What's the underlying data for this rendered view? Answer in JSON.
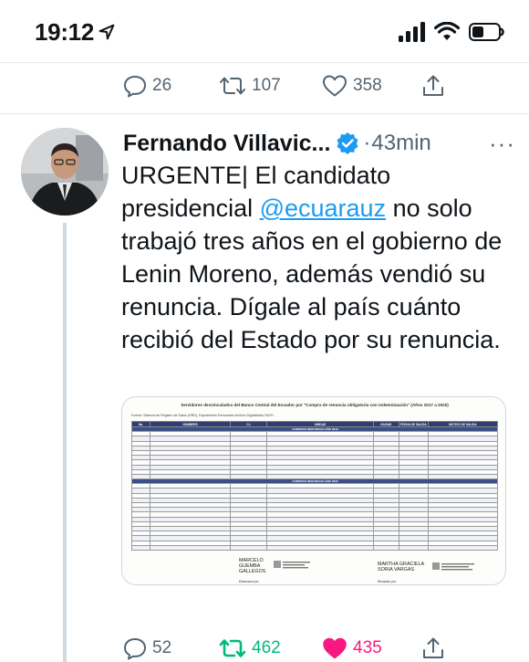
{
  "status_bar": {
    "time": "19:12"
  },
  "top_actions": {
    "reply_count": "26",
    "retweet_count": "107",
    "like_count": "358"
  },
  "tweet": {
    "author": "Fernando Villavic...",
    "time": "43min",
    "more": "···",
    "text_before_mention": "URGENTE| El candidato presidencial ",
    "mention": "@ecuarauz",
    "text_after_mention": " no solo trabajó tres años en el gobierno de Lenin Moreno, además vendió su renuncia. Dígale al país cuánto recibió del Estado por su renuncia.",
    "reply_count": "52",
    "retweet_count": "462",
    "like_count": "435"
  },
  "attached_image": {
    "title": "Servidores desvinculados del Banco Central del Ecuador por \"Compra de renuncia obligatoria con indemnización\" (Años 2017 a 2020)",
    "source": "Fuente: Sistema de Registro de Datos (RRD), Expedientes Personales Archivo Digitalizado DATH",
    "columns": [
      "No.",
      "NOMBRES",
      "C.I.",
      "UNIDAD",
      "CIUDAD",
      "FECHA DE SALIDA",
      "MOTIVO DE SALIDA"
    ],
    "section_2019": "COMPRAS RENUNCIAS AÑO 2019",
    "section_2020": "COMPRAS RENUNCIAS AÑO 2020",
    "signature_left": "MARCELO GUEMBA GALLEGOS",
    "signature_right": "MARTHA GRACIELA SORIA VARGAS",
    "prepared_by": "Elaborado por:",
    "reviewed_by": "Revisado por:"
  },
  "colors": {
    "accent": "#1d9bf0",
    "retweet_active": "#00ba7c",
    "like_active": "#f91880",
    "muted": "#536471"
  }
}
